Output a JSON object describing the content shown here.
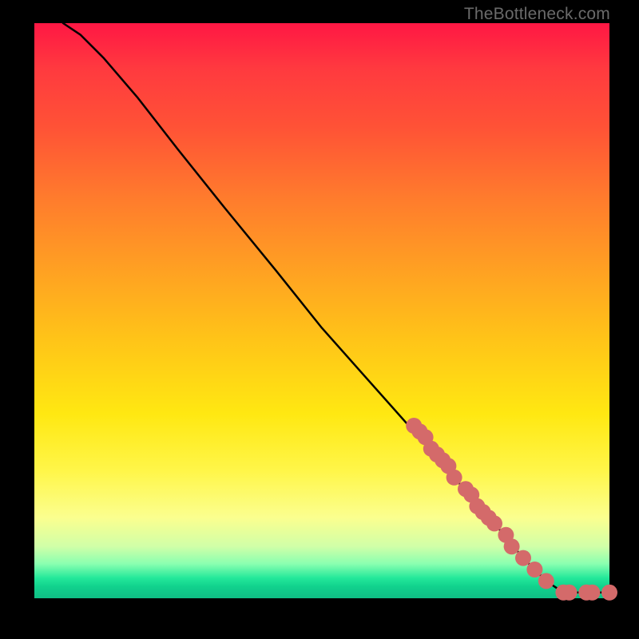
{
  "attribution": "TheBottleneck.com",
  "chart_data": {
    "type": "line",
    "title": "",
    "xlabel": "",
    "ylabel": "",
    "xlim": [
      0,
      100
    ],
    "ylim": [
      0,
      100
    ],
    "grid": false,
    "legend": false,
    "curve": {
      "name": "curve",
      "color": "#000000",
      "points": [
        {
          "x": 5,
          "y": 100
        },
        {
          "x": 8,
          "y": 98
        },
        {
          "x": 12,
          "y": 94
        },
        {
          "x": 18,
          "y": 87
        },
        {
          "x": 25,
          "y": 78
        },
        {
          "x": 33,
          "y": 68
        },
        {
          "x": 42,
          "y": 57
        },
        {
          "x": 50,
          "y": 47
        },
        {
          "x": 58,
          "y": 38
        },
        {
          "x": 66,
          "y": 29
        },
        {
          "x": 73,
          "y": 21
        },
        {
          "x": 80,
          "y": 13
        },
        {
          "x": 85,
          "y": 7
        },
        {
          "x": 89,
          "y": 3
        },
        {
          "x": 92,
          "y": 1
        },
        {
          "x": 100,
          "y": 1
        }
      ]
    },
    "markers": {
      "name": "markers",
      "color": "#d46a6a",
      "radius": 10,
      "points": [
        {
          "x": 66,
          "y": 30
        },
        {
          "x": 67,
          "y": 29
        },
        {
          "x": 68,
          "y": 28
        },
        {
          "x": 69,
          "y": 26
        },
        {
          "x": 70,
          "y": 25
        },
        {
          "x": 71,
          "y": 24
        },
        {
          "x": 72,
          "y": 23
        },
        {
          "x": 73,
          "y": 21
        },
        {
          "x": 75,
          "y": 19
        },
        {
          "x": 76,
          "y": 18
        },
        {
          "x": 77,
          "y": 16
        },
        {
          "x": 78,
          "y": 15
        },
        {
          "x": 79,
          "y": 14
        },
        {
          "x": 80,
          "y": 13
        },
        {
          "x": 82,
          "y": 11
        },
        {
          "x": 83,
          "y": 9
        },
        {
          "x": 85,
          "y": 7
        },
        {
          "x": 87,
          "y": 5
        },
        {
          "x": 89,
          "y": 3
        },
        {
          "x": 92,
          "y": 1
        },
        {
          "x": 93,
          "y": 1
        },
        {
          "x": 96,
          "y": 1
        },
        {
          "x": 97,
          "y": 1
        },
        {
          "x": 100,
          "y": 1
        }
      ]
    }
  }
}
